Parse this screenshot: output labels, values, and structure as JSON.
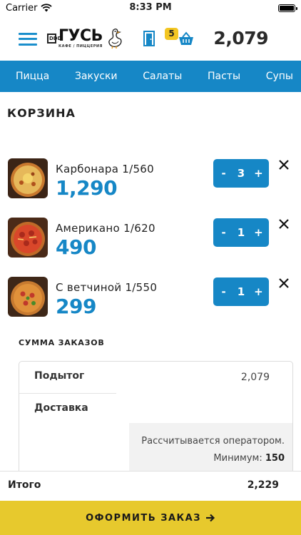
{
  "status_bar": {
    "carrier": "Carrier",
    "time": "8:33 PM"
  },
  "header": {
    "logo_badge": "DDD",
    "logo_name": "ГУСЬ",
    "logo_sub": "КАФЕ / ПИЦЦЕРИЯ",
    "cart_count": "5",
    "cart_total": "2,079"
  },
  "nav": {
    "items": [
      "Пицца",
      "Закуски",
      "Салаты",
      "Пасты",
      "Супы"
    ]
  },
  "page_title": "КОРЗИНА",
  "cart_items": [
    {
      "name": "Карбонара 1/560",
      "price": "1,290",
      "qty": "3"
    },
    {
      "name": "Американо 1/620",
      "price": "490",
      "qty": "1"
    },
    {
      "name": "С ветчиной 1/550",
      "price": "299",
      "qty": "1"
    }
  ],
  "qty_minus": "-",
  "qty_plus": "+",
  "summary": {
    "title": "СУММА ЗАКАЗОВ",
    "subtotal_label": "Подытог",
    "subtotal_value": "2,079",
    "delivery_label": "Доставка",
    "delivery_note": "Рассчитывается оператором.",
    "minimum_label": "Минимум:",
    "minimum_value": "150"
  },
  "total": {
    "label": "Итого",
    "value": "2,229"
  },
  "checkout_label": "ОФОРМИТЬ ЗАКАЗ",
  "colors": {
    "accent": "#1687c6",
    "checkout": "#e7c92d",
    "badge": "#f3c623"
  }
}
